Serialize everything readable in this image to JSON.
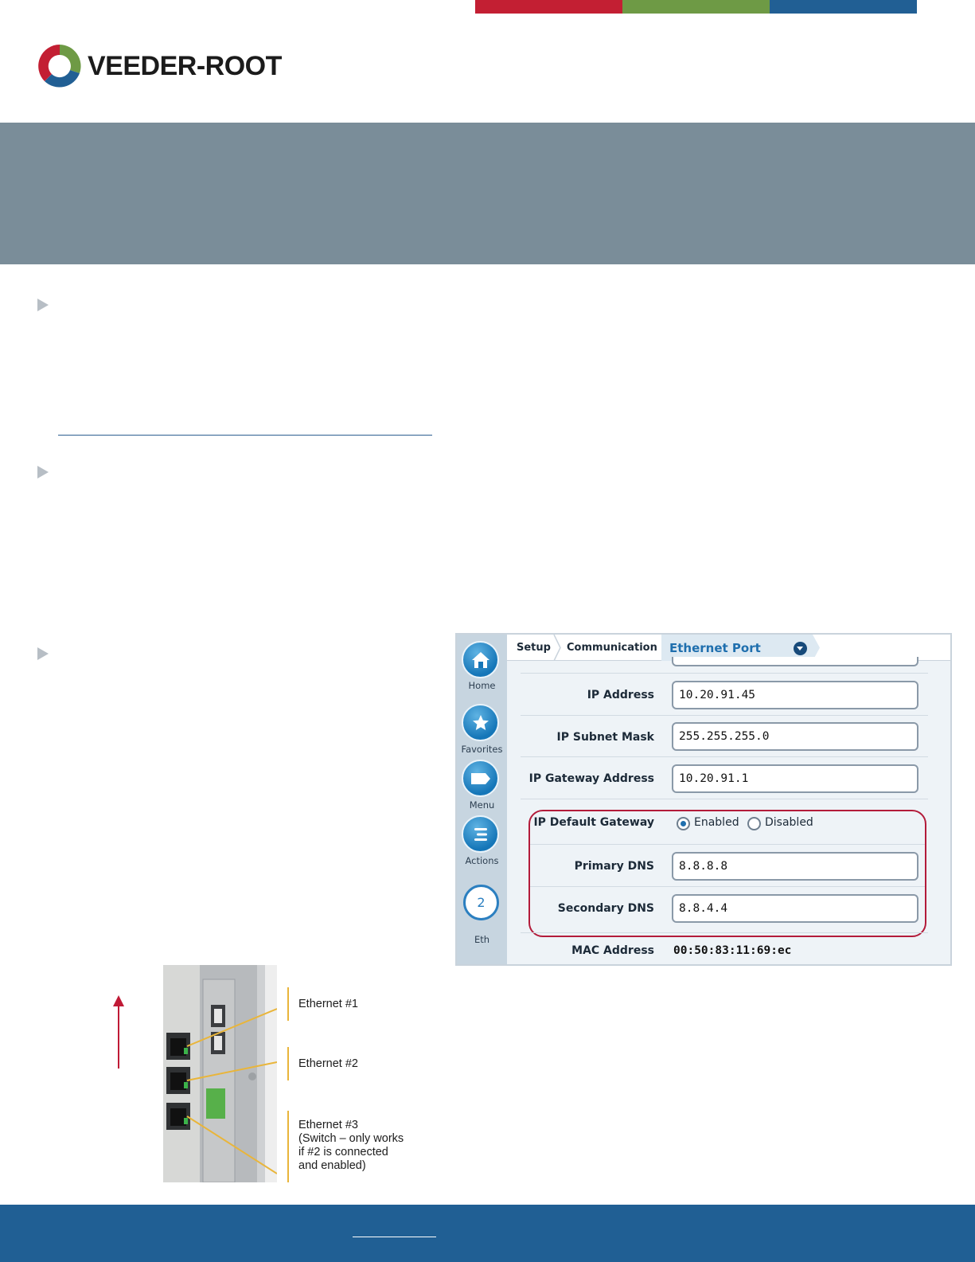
{
  "colors": {
    "strip_red": "#c31f33",
    "strip_green": "#6e9a45",
    "strip_blue": "#215f94",
    "banner_gray": "#7a8d99",
    "footer_blue": "#205f94",
    "highlight_red": "#b31b3a"
  },
  "logo": {
    "text": "VEEDER-ROOT",
    "icon": "veeder-root-triangle-logo"
  },
  "tls_screen": {
    "sidebar": [
      {
        "label": "Home",
        "icon": "home-icon"
      },
      {
        "label": "Favorites",
        "icon": "star-icon"
      },
      {
        "label": "Menu",
        "icon": "menu-tag-icon"
      },
      {
        "label": "Actions",
        "icon": "actions-list-icon"
      }
    ],
    "eth_badge": {
      "number": "2",
      "label": "Eth"
    },
    "breadcrumb": {
      "setup": "Setup",
      "communication": "Communication",
      "active": "Ethernet Port"
    },
    "fields": {
      "ip_address": {
        "label": "IP Address",
        "value": "10.20.91.45"
      },
      "subnet_mask": {
        "label": "IP Subnet Mask",
        "value": "255.255.255.0"
      },
      "gateway": {
        "label": "IP Gateway Address",
        "value": "10.20.91.1"
      },
      "default_gateway": {
        "label": "IP Default Gateway",
        "option_enabled": "Enabled",
        "option_disabled": "Disabled",
        "selected": "Enabled"
      },
      "primary_dns": {
        "label": "Primary DNS",
        "value": "8.8.8.8"
      },
      "secondary_dns": {
        "label": "Secondary DNS",
        "value": "8.8.4.4"
      },
      "mac": {
        "label": "MAC Address",
        "value": "00:50:83:11:69:ec"
      }
    }
  },
  "photo_callouts": {
    "eth1": "Ethernet #1",
    "eth2": "Ethernet #2",
    "eth3_line1": "Ethernet #3",
    "eth3_line2": "(Switch – only works",
    "eth3_line3": "if #2 is connected",
    "eth3_line4": "and enabled)"
  }
}
